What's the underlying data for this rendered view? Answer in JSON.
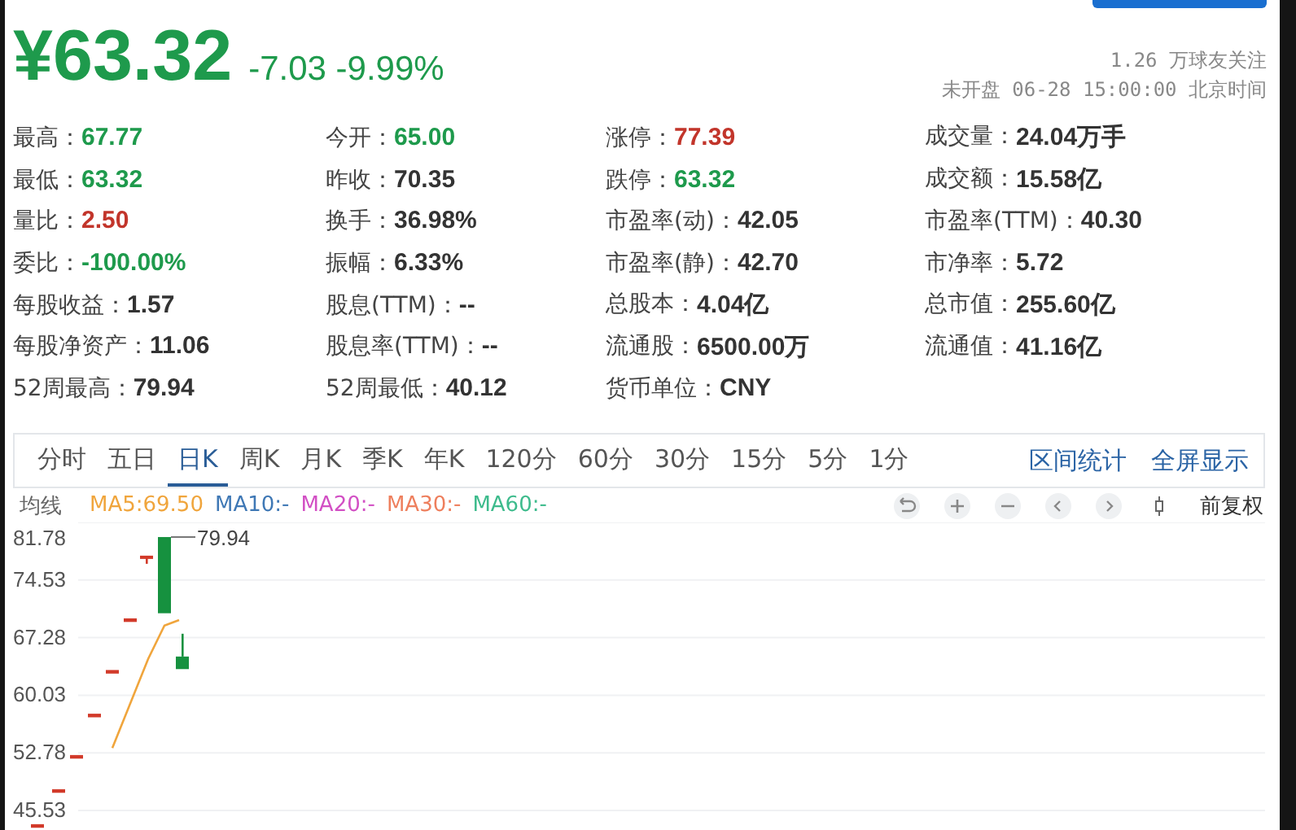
{
  "header": {
    "price": "¥63.32",
    "change": "-7.03",
    "change_percent": "-9.99%",
    "followers": "1.26 万球友关注",
    "status": "未开盘 06-28 15:00:00 北京时间"
  },
  "stats": [
    [
      {
        "label": "最高：",
        "value": "67.77",
        "color": "#1e9a4c"
      },
      {
        "label": "今开：",
        "value": "65.00",
        "color": "#1e9a4c"
      },
      {
        "label": "涨停：",
        "value": "77.39",
        "color": "#c2352b"
      },
      {
        "label": "成交量：",
        "value": "24.04万手",
        "color": "#333333"
      }
    ],
    [
      {
        "label": "最低：",
        "value": "63.32",
        "color": "#1e9a4c"
      },
      {
        "label": "昨收：",
        "value": "70.35",
        "color": "#333333"
      },
      {
        "label": "跌停：",
        "value": "63.32",
        "color": "#1e9a4c"
      },
      {
        "label": "成交额：",
        "value": "15.58亿",
        "color": "#333333"
      }
    ],
    [
      {
        "label": "量比：",
        "value": "2.50",
        "color": "#c2352b"
      },
      {
        "label": "换手：",
        "value": "36.98%",
        "color": "#333333"
      },
      {
        "label": "市盈率(动)：",
        "value": "42.05",
        "color": "#333333"
      },
      {
        "label": "市盈率(TTM)：",
        "value": "40.30",
        "color": "#333333"
      }
    ],
    [
      {
        "label": "委比：",
        "value": "-100.00%",
        "color": "#1e9a4c"
      },
      {
        "label": "振幅：",
        "value": "6.33%",
        "color": "#333333"
      },
      {
        "label": "市盈率(静)：",
        "value": "42.70",
        "color": "#333333"
      },
      {
        "label": "市净率：",
        "value": "5.72",
        "color": "#333333"
      }
    ],
    [
      {
        "label": "每股收益：",
        "value": "1.57",
        "color": "#333333"
      },
      {
        "label": "股息(TTM)：",
        "value": "--",
        "color": "#333333"
      },
      {
        "label": "总股本：",
        "value": "4.04亿",
        "color": "#333333"
      },
      {
        "label": "总市值：",
        "value": "255.60亿",
        "color": "#333333"
      }
    ],
    [
      {
        "label": "每股净资产：",
        "value": "11.06",
        "color": "#333333"
      },
      {
        "label": "股息率(TTM)：",
        "value": "--",
        "color": "#333333"
      },
      {
        "label": "流通股：",
        "value": "6500.00万",
        "color": "#333333"
      },
      {
        "label": "流通值：",
        "value": "41.16亿",
        "color": "#333333"
      }
    ],
    [
      {
        "label": "52周最高：",
        "value": "79.94",
        "color": "#333333"
      },
      {
        "label": "52周最低：",
        "value": "40.12",
        "color": "#333333"
      },
      {
        "label": "货币单位：",
        "value": "CNY",
        "color": "#333333"
      }
    ]
  ],
  "tabs": [
    {
      "label": "分时",
      "selected": false
    },
    {
      "label": "五日",
      "selected": false
    },
    {
      "label": "日K",
      "selected": true
    },
    {
      "label": "周K",
      "selected": false
    },
    {
      "label": "月K",
      "selected": false
    },
    {
      "label": "季K",
      "selected": false
    },
    {
      "label": "年K",
      "selected": false
    },
    {
      "label": "120分",
      "selected": false
    },
    {
      "label": "60分",
      "selected": false
    },
    {
      "label": "30分",
      "selected": false
    },
    {
      "label": "15分",
      "selected": false
    },
    {
      "label": "5分",
      "selected": false
    },
    {
      "label": "1分",
      "selected": false
    }
  ],
  "links": [
    "区间统计",
    "全屏显示"
  ],
  "moving_averages": {
    "label": "均线",
    "lines": [
      {
        "text": "MA5:69.50",
        "color": "#f0a53c"
      },
      {
        "text": "MA10:-",
        "color": "#3f78b5"
      },
      {
        "text": "MA20:-",
        "color": "#d24fc4"
      },
      {
        "text": "MA30:-",
        "color": "#ee7f5d"
      },
      {
        "text": "MA60:-",
        "color": "#3dbb8c"
      }
    ]
  },
  "toolbar": {
    "buttons": [
      {
        "kind": "reset"
      },
      {
        "kind": "zoom_in"
      },
      {
        "kind": "zoom_out"
      },
      {
        "kind": "left"
      },
      {
        "kind": "right"
      },
      {
        "kind": "candle"
      }
    ],
    "adjust": "前复权"
  },
  "chart": {
    "yticks": [
      "81.78",
      "74.53",
      "67.28",
      "60.03",
      "52.78",
      "45.53"
    ],
    "high_label": "79.94"
  }
}
